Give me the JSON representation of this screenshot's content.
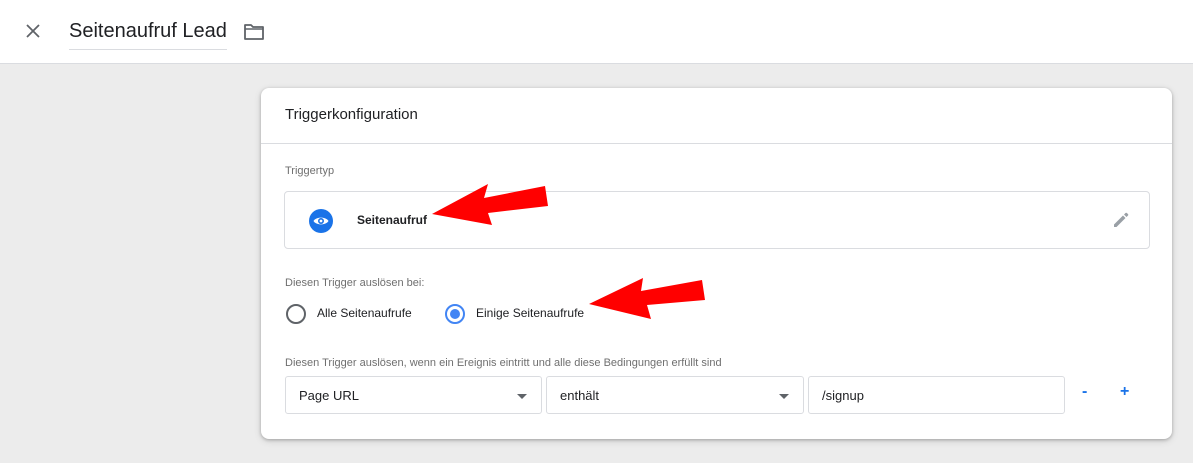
{
  "header": {
    "title": "Seitenaufruf Lead",
    "close_icon": "close-icon",
    "folder_icon": "folder-icon"
  },
  "card": {
    "title": "Triggerkonfiguration",
    "trigger_type_label": "Triggertyp",
    "trigger_type": {
      "name": "Seitenaufruf",
      "icon": "eye-icon",
      "edit_icon": "pencil-icon"
    },
    "fire_on_label": "Diesen Trigger auslösen bei:",
    "radio_options": [
      {
        "label": "Alle Seitenaufrufe",
        "checked": false
      },
      {
        "label": "Einige Seitenaufrufe",
        "checked": true
      }
    ],
    "condition_label": "Diesen Trigger auslösen, wenn ein Ereignis eintritt und alle diese Bedingungen erfüllt sind",
    "condition": {
      "variable": "Page URL",
      "operator": "enthält",
      "value": "/signup",
      "remove_label": "-",
      "add_label": "+"
    }
  },
  "annotations": {
    "arrow_color": "#ff0000"
  },
  "colors": {
    "accent": "#1a73e8",
    "radio_checked": "#4285f4",
    "background": "#ececec"
  }
}
